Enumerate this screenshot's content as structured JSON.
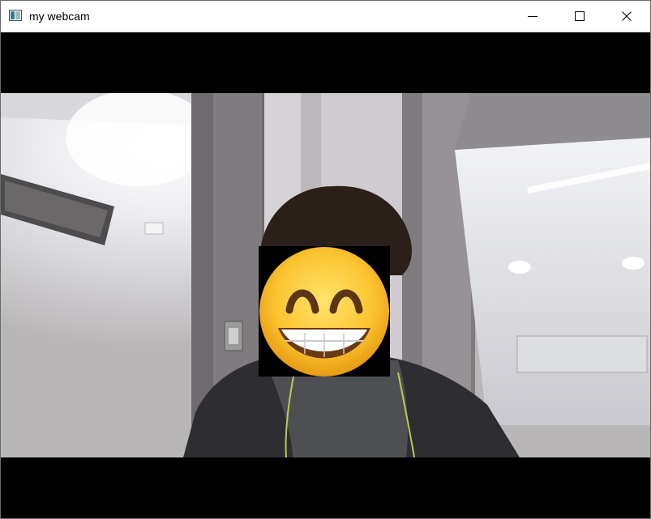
{
  "window": {
    "title": "my webcam",
    "app_icon": "opencv-window-icon",
    "controls": {
      "minimize_icon": "minimize-icon",
      "maximize_icon": "maximize-icon",
      "close_icon": "close-icon"
    }
  },
  "video": {
    "content": "webcam-feed",
    "overlay": "grinning-face-emoji"
  }
}
